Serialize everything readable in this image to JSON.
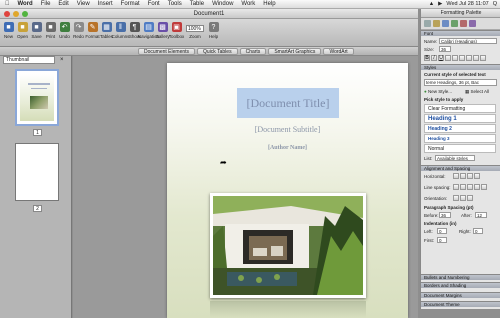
{
  "menubar": {
    "apple": "",
    "items": [
      "Word",
      "File",
      "Edit",
      "View",
      "Insert",
      "Format",
      "Font",
      "Tools",
      "Table",
      "Window",
      "Work",
      "Help"
    ],
    "right": {
      "clock": "Wed Jul 28 11:07",
      "search": "Q"
    }
  },
  "window": {
    "title": "Document1"
  },
  "toolbar": {
    "buttons": [
      {
        "label": "New",
        "color": "#3f6db5"
      },
      {
        "label": "Open",
        "color": "#c8a23a"
      },
      {
        "label": "Save",
        "color": "#5a6a8a"
      },
      {
        "label": "Print",
        "color": "#6b6b6b"
      },
      {
        "label": "Undo",
        "color": "#3f7f3f"
      },
      {
        "label": "Redo",
        "color": "#8a8a8a"
      },
      {
        "label": "Format",
        "color": "#b8732a"
      },
      {
        "label": "Tables",
        "color": "#4a6fa8"
      },
      {
        "label": "Columns",
        "color": "#4a6fa8"
      },
      {
        "label": "Show",
        "color": "#555"
      },
      {
        "label": "Navigation",
        "color": "#4f7cc4"
      },
      {
        "label": "Gallery",
        "color": "#6a4fa8"
      },
      {
        "label": "Toolbox",
        "color": "#c03b3b"
      }
    ],
    "zoom": {
      "value": "100%",
      "label": "Zoom"
    },
    "help_label": "Help"
  },
  "ribbon": {
    "tabs": [
      "Document Elements",
      "Quick Tables",
      "Charts",
      "SmartArt Graphics",
      "WordArt"
    ]
  },
  "sidebar": {
    "view": "Thumbnail",
    "pages": [
      "1",
      "2"
    ]
  },
  "document": {
    "title": "[Document Title]",
    "subtitle": "[Document Subtitle]",
    "author": "[Author Name]"
  },
  "palette": {
    "title": "Formatting Palette",
    "font": {
      "section": "Font",
      "name_label": "Name:",
      "name_value": "Calibri (Headings)",
      "size_label": "Size:",
      "size_value": "36"
    },
    "styles": {
      "section": "Styles",
      "current_label": "Current style of selected text",
      "current_value": "teme Headings, 36 pt, Bac",
      "new_style": "New Style...",
      "select_all": "Select All",
      "pick_label": "Pick style to apply",
      "list": [
        "Clear Formatting",
        "Heading 1",
        "Heading 2",
        "Heading 3",
        "Normal"
      ],
      "list_label": "List:",
      "list_value": "Available styles"
    },
    "alignment": {
      "section": "Alignment and Spacing",
      "horizontal": "Horizontal:",
      "line_spacing": "Line spacing:",
      "orientation": "Orientation:",
      "para_spacing": "Paragraph Spacing (pt)",
      "before_label": "Before:",
      "before_value": "36",
      "after_label": "After:",
      "after_value": "12",
      "indentation": "Indentation (in)",
      "left_label": "Left:",
      "left_value": "0",
      "right_label": "Right:",
      "right_value": "0",
      "first_label": "First:",
      "first_value": "0"
    },
    "collapsed": [
      "Bullets and Numbering",
      "Borders and Shading",
      "Document Margins",
      "Document Theme"
    ]
  }
}
